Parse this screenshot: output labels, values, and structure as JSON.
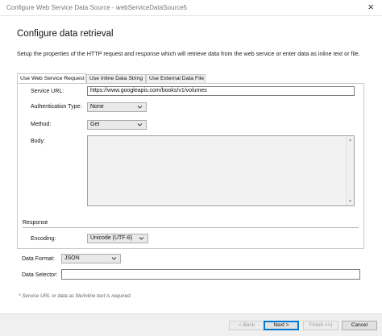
{
  "window": {
    "title": "Configure Web Service Data Source - webServiceDataSource5",
    "close_glyph": "×"
  },
  "heading": "Configure data retrieval",
  "description": "Setup the properties of the HTTP request and response which will retrieve data from the web service or enter data as inline text or file.",
  "tabs": [
    {
      "label": "Use Web Service Request",
      "active": true
    },
    {
      "label": "Use Inline Data String",
      "active": false
    },
    {
      "label": "Use External Data File",
      "active": false
    }
  ],
  "request": {
    "service_url_label": "Service URL:",
    "service_url_value": "https://www.googleapis.com/books/v1/volumes",
    "auth_label": "Authentication Type:",
    "auth_value": "None",
    "method_label": "Method:",
    "method_value": "Get",
    "body_label": "Body:",
    "body_value": ""
  },
  "response": {
    "section_label": "Response",
    "encoding_label": "Encoding:",
    "encoding_value": "Unicode (UTF-8)"
  },
  "data_format_label": "Data Format:",
  "data_format_value": "JSON",
  "data_selector_label": "Data Selector:",
  "data_selector_value": "",
  "footnote": "* Service URL or data as file/inline text is required.",
  "buttons": {
    "back": "< Back",
    "next": "Next >",
    "finish": "Finish >>|",
    "cancel": "Cancel"
  },
  "colors": {
    "accent": "#0078d7",
    "dialog_bg": "#ffffff",
    "button_bar": "#f0f0f0"
  }
}
